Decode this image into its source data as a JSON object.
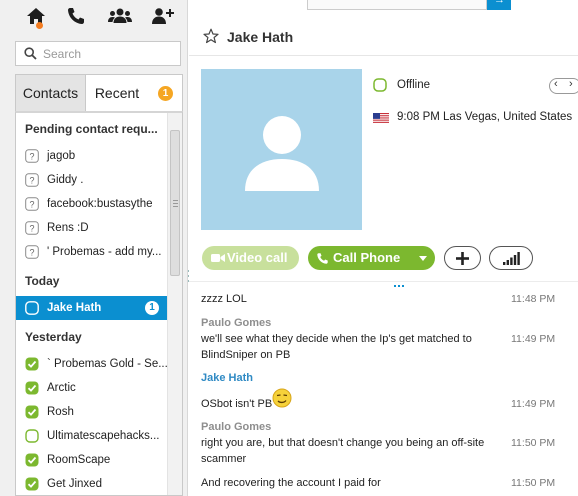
{
  "icons": [
    "home-icon",
    "call-icon",
    "contacts-icon",
    "add-contact-icon",
    "search-icon",
    "star-icon",
    "default-avatar-icon",
    "offline-presence-icon",
    "us-flag-icon",
    "video-icon",
    "phone-icon",
    "plus-icon",
    "signal-icon",
    "emoticon-icon"
  ],
  "colors": {
    "accent": "#0b8fd0",
    "call_green": "#7cb82f",
    "video_disabled": "#c8e09c",
    "badge_orange": "#f5a623",
    "avatar_bg": "#a9d4ea",
    "self_name": "#2f8ac4"
  },
  "search": {
    "placeholder": "Search"
  },
  "tabs": {
    "contacts": "Contacts",
    "recent": "Recent",
    "recent_badge": "1"
  },
  "list": {
    "pending_header": "Pending contact requ...",
    "pending": [
      "jagob",
      "Giddy .",
      "facebook:bustasythe",
      "Rens :D",
      "' Probemas - add my..."
    ],
    "today_header": "Today",
    "today": [
      {
        "label": "Jake Hath",
        "badge": "1"
      }
    ],
    "yesterday_header": "Yesterday",
    "yesterday": [
      "` Probemas Gold - Se...",
      "Arctic",
      "Rosh",
      "Ultimatescapehacks...",
      "RoomScape",
      "Get Jinxed"
    ]
  },
  "conversation": {
    "title": "Jake Hath",
    "status": "Offline",
    "local_time": "9:08 PM Las Vegas, United States",
    "video_call": "Video call",
    "call_phone": "Call Phone",
    "messages": [
      {
        "sender": "",
        "lines": [
          "zzzz LOL"
        ],
        "time": "11:48 PM"
      },
      {
        "sender": "Paulo Gomes",
        "lines": [
          "we'll see what they decide when the Ip's get matched to",
          "BlindSniper on PB"
        ],
        "time": "11:49 PM"
      },
      {
        "sender": "Jake Hath",
        "lines": [
          "OSbot isn't PB"
        ],
        "time": "11:49 PM"
      },
      {
        "sender": "Paulo Gomes",
        "lines": [
          "right you are, but that doesn't change you being an off-site",
          "scammer"
        ],
        "time": "11:50 PM"
      },
      {
        "sender": "",
        "lines": [
          "And recovering the account I paid for"
        ],
        "time": "11:50 PM"
      }
    ]
  }
}
